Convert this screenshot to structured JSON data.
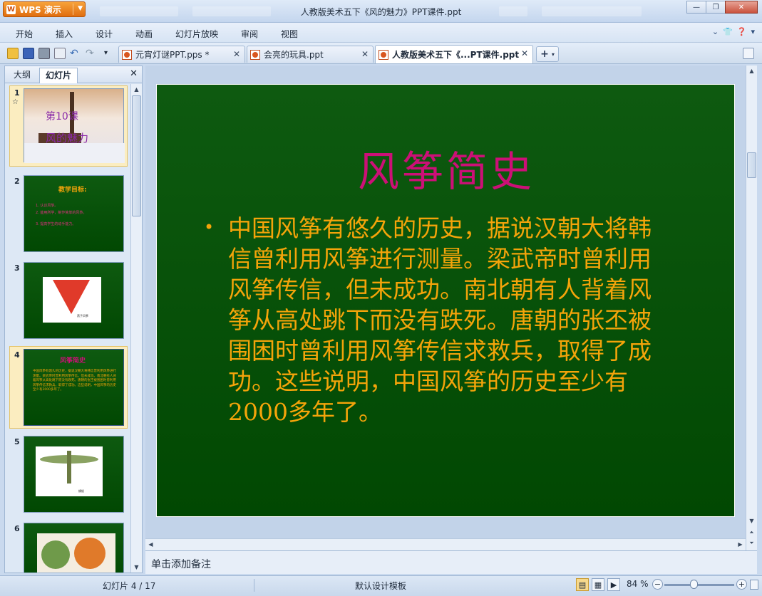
{
  "app": {
    "name": "WPS 演示",
    "logo": "W",
    "window_title": "人教版美术五下《风的魅力》PPT课件.ppt"
  },
  "menu": [
    "开始",
    "插入",
    "设计",
    "动画",
    "幻灯片放映",
    "审阅",
    "视图"
  ],
  "tabs": [
    {
      "label": "元宵灯谜PPT.pps *",
      "active": false
    },
    {
      "label": "会亮的玩具.ppt",
      "active": false
    },
    {
      "label": "人教版美术五下《...PT课件.ppt",
      "active": true
    }
  ],
  "panel": {
    "tabs": [
      "大纲",
      "幻灯片"
    ],
    "active_tab": "幻灯片"
  },
  "thumbnails": [
    {
      "num": "1",
      "line1": "第10课",
      "line2": "风的魅力",
      "star": "☆"
    },
    {
      "num": "2",
      "heading": "教学目标:",
      "lines": [
        "1. 认识风筝。",
        "2. 能用所学，制作简单的风筝。",
        "3. 提高学生的动手能力。"
      ]
    },
    {
      "num": "3",
      "caption": "燕子风筝"
    },
    {
      "num": "4",
      "heading": "风筝简史",
      "body": "中国风筝有悠久的历史，据说汉朝大将韩信曾利用风筝进行测量。梁武帝时曾利用风筝传信，但未成功。南北朝有人背着风筝从高处跳下而没有跌死。唐朝的张丕被围困时曾利用风筝传信求救兵，取得了成功。这些说明，中国风筝的历史至少有2000多年了。"
    },
    {
      "num": "5",
      "caption": "蜻蜓"
    },
    {
      "num": "6",
      "caption": ""
    }
  ],
  "slide": {
    "title": "风筝简史",
    "body": "中国风筝有悠久的历史，据说汉朝大将韩信曾利用风筝进行测量。梁武帝时曾利用风筝传信，但未成功。南北朝有人背着风筝从高处跳下而没有跌死。唐朝的张丕被围困时曾利用风筝传信求救兵，取得了成功。这些说明，中国风筝的历史至少有2000多年了。",
    "bullet": "•"
  },
  "notes_placeholder": "单击添加备注",
  "status": {
    "slide_counter": "幻灯片 4 / 17",
    "template": "默认设计模板",
    "zoom": "84 %"
  },
  "colors": {
    "slide_bg": "#0a560c",
    "title": "#cc1077",
    "body": "#f4a40a",
    "accent": "#f08a1e"
  }
}
